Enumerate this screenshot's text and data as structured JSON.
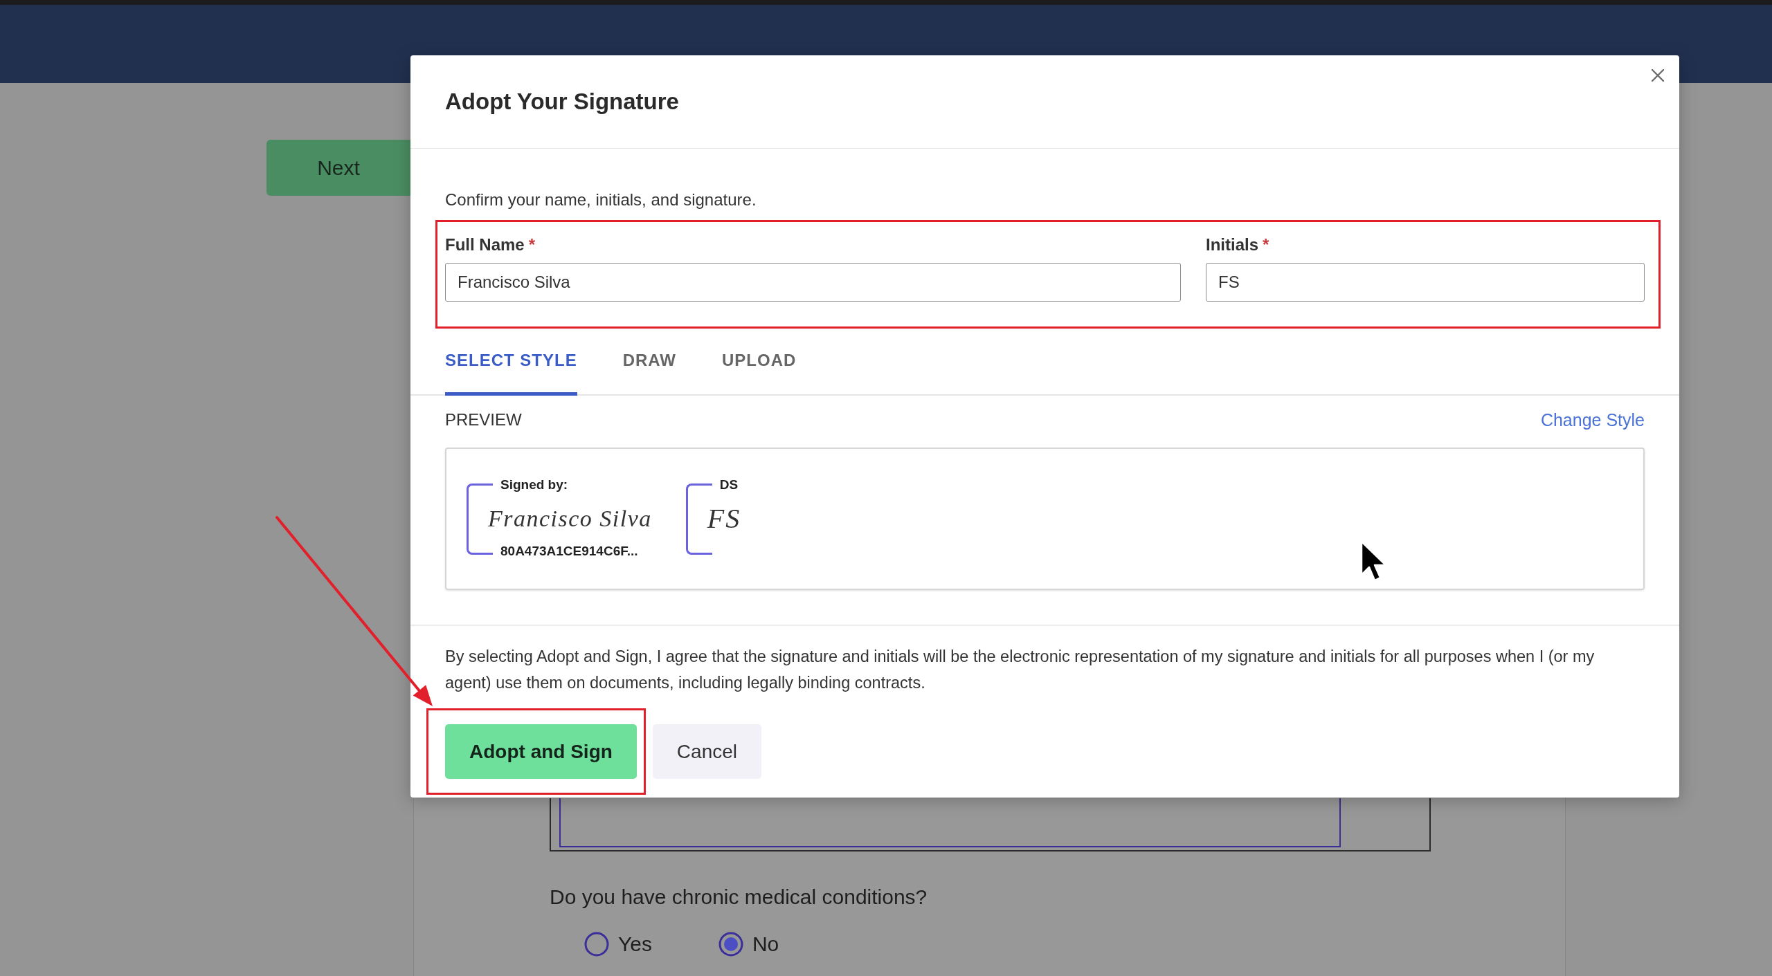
{
  "page": {
    "next_button": "Next",
    "question": "Do you have chronic medical conditions?",
    "options": [
      {
        "label": "Yes",
        "selected": false
      },
      {
        "label": "No",
        "selected": true
      }
    ]
  },
  "dialog": {
    "title": "Adopt Your Signature",
    "instruction": "Confirm your name, initials, and signature.",
    "fields_highlighted": true,
    "fields": [
      {
        "label": "Full Name",
        "required_mark": "*",
        "value": "Francisco Silva"
      },
      {
        "label": "Initials",
        "required_mark": "*",
        "value": "FS"
      }
    ],
    "tabs": [
      {
        "label": "SELECT STYLE",
        "selected": true
      },
      {
        "label": "DRAW",
        "selected": false
      },
      {
        "label": "UPLOAD",
        "selected": false
      }
    ],
    "preview": {
      "label": "PREVIEW",
      "change_style_link": "Change Style",
      "stamps": [
        {
          "kind": "signature",
          "caption": "Signed by:",
          "signature": "Francisco Silva",
          "code": "80A473A1CE914C6F..."
        },
        {
          "kind": "initials",
          "caption": "DS",
          "signature": "FS"
        }
      ]
    },
    "consent": "By selecting Adopt and Sign, I agree that the signature and initials will be the electronic representation of my signature and initials for all purposes when I (or my agent) use them on documents, including legally binding contracts.",
    "buttons": [
      {
        "label": "Adopt and Sign",
        "kind": "primary",
        "highlighted": true
      },
      {
        "label": "Cancel",
        "kind": "secondary",
        "highlighted": false
      }
    ]
  }
}
